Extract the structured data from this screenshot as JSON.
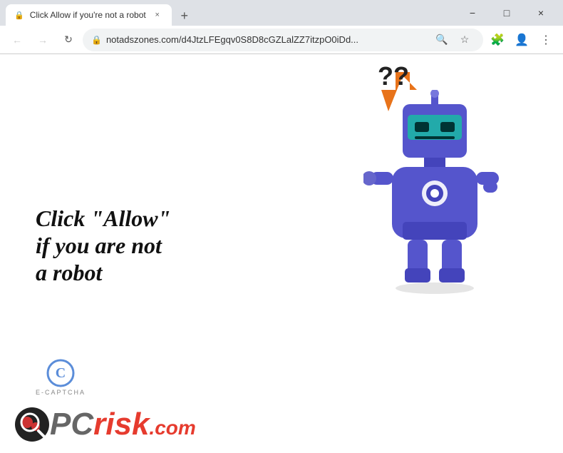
{
  "window": {
    "title": "Click Allow if you're not a robot",
    "tab_favicon": "🔒",
    "tab_close_label": "×",
    "new_tab_label": "+",
    "controls": {
      "minimize": "−",
      "maximize": "□",
      "close": "×"
    }
  },
  "addressbar": {
    "back_arrow": "←",
    "forward_arrow": "→",
    "reload": "↻",
    "lock_icon": "🔒",
    "url": "notadszones.com/d4JtzLFEgqv0S8D8cGZLalZZ7itzpO0iDd...",
    "search_icon": "🔍",
    "star_icon": "☆",
    "extensions_icon": "🧩",
    "profile_icon": "👤",
    "menu_icon": "⋮"
  },
  "page": {
    "heading_line1": "Click \"Allow\"",
    "heading_line2": "if you are not",
    "heading_line3": "a robot",
    "question_marks": "??",
    "captcha_label": "E-CAPTCHA",
    "pcrisk_pc": "PC",
    "pcrisk_risk": "risk",
    "pcrisk_com": ".com"
  },
  "colors": {
    "arrow": "#e8731a",
    "robot_body": "#5555cc",
    "robot_visor": "#22aaaa",
    "heading_color": "#111111",
    "captcha_color": "#5b8dd9",
    "risk_color": "#e63b2e",
    "pc_color": "#888888"
  }
}
